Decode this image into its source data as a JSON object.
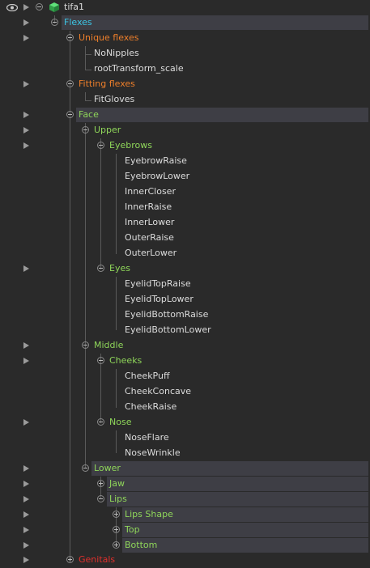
{
  "root": {
    "label": "tifa1"
  },
  "nodes": {
    "flexes": "Flexes",
    "unique": "Unique flexes",
    "nonipples": "NoNipples",
    "roottransform": "rootTransform_scale",
    "fitting": "Fitting flexes",
    "fitgloves": "FitGloves",
    "face": "Face",
    "upper": "Upper",
    "eyebrows": "Eyebrows",
    "eyebrowraise": "EyebrowRaise",
    "eyebrowlower": "EyebrowLower",
    "innercloser": "InnerCloser",
    "innerraise": "InnerRaise",
    "innerlower": "InnerLower",
    "outerraise": "OuterRaise",
    "outerlower": "OuterLower",
    "eyes": "Eyes",
    "eyelidtopraise": "EyelidTopRaise",
    "eyelidtoplower": "EyelidTopLower",
    "eyelidbottomraise": "EyelidBottomRaise",
    "eyelidbottomlower": "EyelidBottomLower",
    "middle": "Middle",
    "cheeks": "Cheeks",
    "cheekpuff": "CheekPuff",
    "cheekconcave": "CheekConcave",
    "cheekraise": "CheekRaise",
    "nose": "Nose",
    "noseflare": "NoseFlare",
    "nosewrinkle": "NoseWrinkle",
    "lower": "Lower",
    "jaw": "Jaw",
    "lips": "Lips",
    "lipsshape": "Lips Shape",
    "top": "Top",
    "bottom": "Bottom",
    "genitals": "Genitals"
  },
  "colors": {
    "orange": "#ee7f2a",
    "green": "#8fd65a",
    "cyan": "#3cc6e6",
    "red": "#e0302c",
    "highlight": "#3e3e45"
  }
}
